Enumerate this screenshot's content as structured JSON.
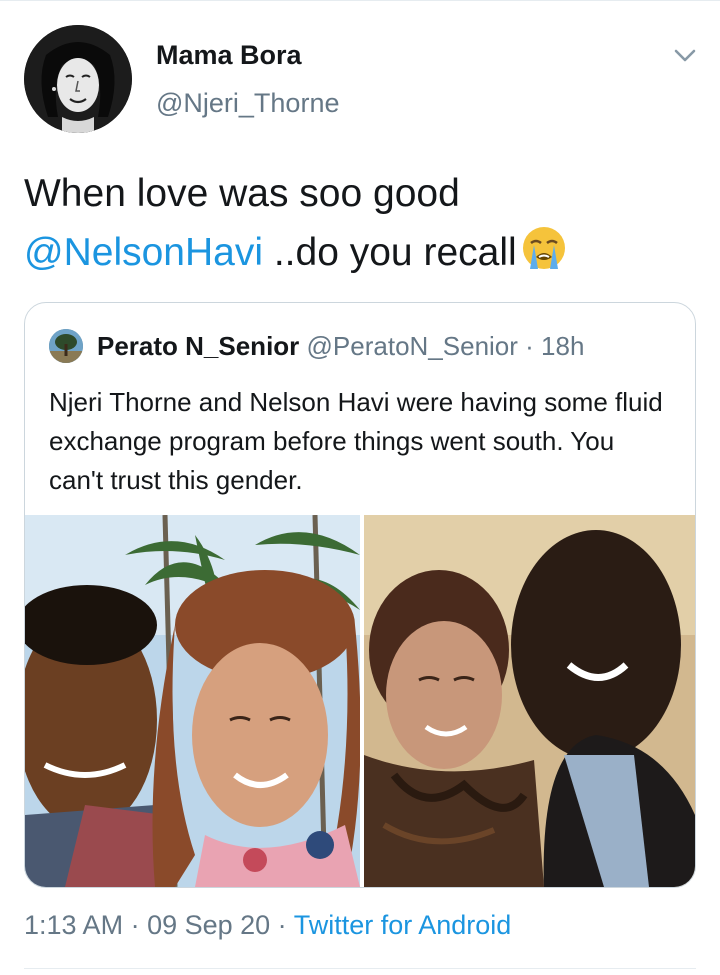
{
  "author": {
    "name": "Mama Bora",
    "handle": "@Njeri_Thorne",
    "avatar_icon": "cartoon-portrait-avatar"
  },
  "tweet": {
    "line1": "When love was soo good",
    "mention": "@NelsonHavi",
    "line2_rest": " ..do you recall",
    "emoji": "loudly-crying-face-emoji"
  },
  "quoted_tweet": {
    "name": "Perato N_Senior",
    "handle": "@PeratoN_Senior",
    "separator": " · ",
    "time_ago": "18h",
    "text": "Njeri Thorne and Nelson Havi were having some fluid exchange program before things went south. You can't trust this gender.",
    "photos": [
      "beach-palm-trees-couple-selfie",
      "indoor-couple-selfie"
    ]
  },
  "meta": {
    "time": "1:13 AM",
    "dot1": " · ",
    "date": "09 Sep 20",
    "dot2": " · ",
    "source": "Twitter for Android"
  },
  "colors": {
    "link": "#1b95e0",
    "secondary_text": "#657786",
    "primary_text": "#14171a",
    "border": "#ccd6dd"
  }
}
